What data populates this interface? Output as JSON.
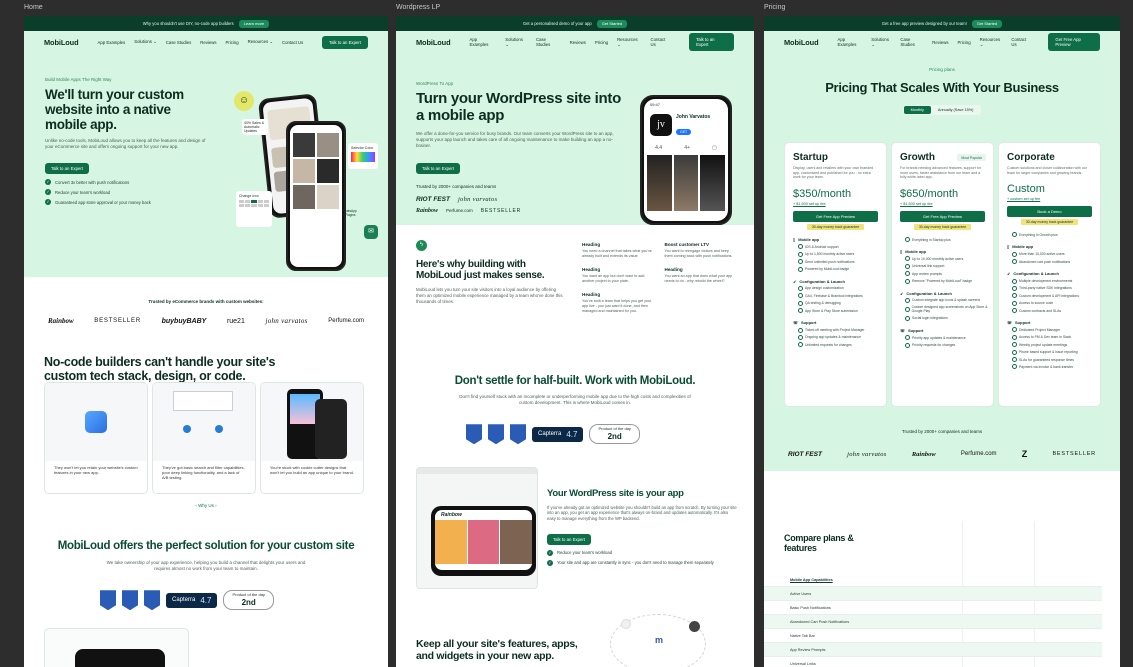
{
  "frames": {
    "home": {
      "label": "Home",
      "topbar": {
        "text": "Why you shouldn't use DIY, no-code app builders",
        "cta": "Learn more"
      },
      "nav": {
        "logo": "MobiLoud",
        "items": [
          "App Examples",
          "Solutions ⌄",
          "Case Studies",
          "Reviews",
          "Pricing",
          "Resources ⌄",
          "Contact Us"
        ],
        "cta": "Talk to an Expert"
      },
      "hero": {
        "eyebrow": "Build Mobile Apps The Right Way",
        "title": "We'll turn your custom website into a native mobile app.",
        "body": "Unlike no-code tools, MobiLoud allows you to keep all the features and design of your eCommerce site and offers ongoing support for your new app.",
        "cta": "Talk to an Expert",
        "checks": [
          "Convert 3x better with push notifications",
          "Reduce your team's workload",
          "Guaranteed app store approval or your money back"
        ]
      },
      "trusted": {
        "title": "Trusted by eCommerce brands with custom websites:",
        "brands": [
          "Rainbow",
          "BESTSELLER",
          "buybuyBABY",
          "rue21",
          "john varvatos",
          "Perfume.com"
        ]
      },
      "nocode": {
        "title": "No-code builders can't handle your site's custom tech stack, design, or code.",
        "cards": [
          "They won't let you retain your website's custom features in your new app.",
          "They've got basic search and filter capabilities, poor deep linking functionality, and a lack of A/B testing.",
          "You're stuck with cookie cutter designs that won't let you build an app unique to your brand."
        ],
        "why_link": "‹ Why Us ›"
      },
      "solution": {
        "title": "MobiLoud offers the perfect solution for your custom site",
        "body": "We take ownership of your app experience, helping you build a channel that delights your users and requires almost no work from your team to maintain."
      },
      "badges": {
        "capterra": "Capterra",
        "capterra_score": "4.7",
        "potd_label": "Product of the day",
        "potd_rank": "2nd"
      },
      "phone_labels": {
        "sale": "40% Sales & Automatic Updates",
        "selector": "Selector Color",
        "change_icon": "Change icon",
        "whatsapp": "WhatsApp & Plugins"
      }
    },
    "wordpress": {
      "label": "Wordpress LP",
      "topbar": {
        "text": "Get a personalised demo of your app",
        "cta": "Get Started"
      },
      "nav": {
        "logo": "MobiLoud",
        "items": [
          "App Examples",
          "Solutions ⌄",
          "Case Studies",
          "Reviews",
          "Pricing",
          "Resources ⌄",
          "Contact Us"
        ],
        "cta": "Talk to an Expert"
      },
      "hero": {
        "eyebrow": "WordPress To App",
        "title": "Turn your WordPress site into a mobile app",
        "body": "We offer a done-for-you service for busy brands. Our team converts your WordPress site to an app, supports your app launch and takes care of all ongoing maintenance to make building an app a no-brainer.",
        "cta": "Talk to an Expert",
        "trusted": "Trusted by 2000+ companies and teams",
        "brands": [
          "RIOT FEST",
          "john varvatos",
          "Rainbow",
          "Perfume.com",
          "BESTSELLER"
        ]
      },
      "phone": {
        "time": "09:47",
        "name": "John Varvatos",
        "rating": "4.4",
        "age": "4+",
        "get": "GET"
      },
      "why": {
        "title": "Here's why building with MobiLoud just makes sense.",
        "body": "MobiLoud lets you turn your site visitors into a loyal audience by offering them an optimized mobile experience managed by a team who've done this thousands of times.",
        "features": [
          {
            "title": "Heading",
            "body": "You need a channel that takes what you've already built and extends its value."
          },
          {
            "title": "Boost customer LTV",
            "body": "You want to reengage visitors and keep them coming back with push notifications."
          },
          {
            "title": "Heading",
            "body": "You want an app but don't want to add another project to your plate."
          },
          {
            "title": "Heading",
            "body": "You want an app that does what your app needs to do - why rebuild the wheel?"
          },
          {
            "title": "Heading",
            "body": "You've built a team that helps you get your app live - you just want it done, and then managed and maintained for you."
          }
        ]
      },
      "dont_settle": {
        "title": "Don't settle for half-built. Work with MobiLoud.",
        "body": "Don't find yourself stuck with an incomplete or underperforming mobile app due to the high costs and complexities of custom development. This is where MobiLoud comes in."
      },
      "badges": {
        "capterra": "Capterra",
        "capterra_score": "4.7",
        "potd_label": "Product of the day",
        "potd_rank": "2nd"
      },
      "your_app": {
        "title": "Your WordPress site is your app",
        "body": "If you've already got an optimized website you shouldn't build an app from scratch. By turning your site into an app, you get an app experience that's always on-brand and updates automatically. It's also easy to manage everything from the WP backend.",
        "cta": "Talk to an Expert",
        "checks": [
          "Reduce your team's workload",
          "Your site and app are constantly in sync - you don't need to manage them separately"
        ]
      },
      "keep": {
        "title": "Keep all your site's features, apps, and widgets in your new app."
      }
    },
    "pricing": {
      "label": "Pricing",
      "topbar": {
        "text": "Get a free app preview designed by our team!",
        "cta": "Get Started"
      },
      "nav": {
        "logo": "MobiLoud",
        "items": [
          "App Examples",
          "Solutions ⌄",
          "Case Studies",
          "Reviews",
          "Pricing",
          "Resources ⌄",
          "Contact Us"
        ],
        "cta": "Get Free App Preview"
      },
      "eyebrow": "Pricing plans",
      "title": "Pricing That Scales With Your Business",
      "toggle": {
        "monthly": "Monthly",
        "annual": "Annually (Save 15%)"
      },
      "plans": [
        {
          "name": "Startup",
          "desc": "Display, users and retailers with your own branded app, customized and published for you - no extra work for your team.",
          "price": "$350/month",
          "setup": "+ $1,500 set up fee",
          "cta": "Get Free App Preview",
          "guarantee": "30-day money back guarantee",
          "popular": "",
          "sections": [
            {
              "title": "Mobile app",
              "items": [
                "iOS & Android support",
                "Up to 1,500 monthly active users",
                "Send unlimited push notifications",
                "Powered by MobiLoud badge"
              ]
            },
            {
              "title": "Configuration & Launch",
              "items": [
                "App design customization",
                "GA4, Firebase & Braintool integrations",
                "QA testing & debugging",
                "App Store & Play Store submission"
              ]
            },
            {
              "title": "Support",
              "items": [
                "Ticket-off meeting with Project Manager",
                "Ongoing app updates & maintenance",
                "Unlimited requests for changes"
              ]
            }
          ]
        },
        {
          "name": "Growth",
          "desc": "For brands needing advanced features, support for more users, faster assistance from our team and a fully white-label app.",
          "price": "$650/month",
          "setup": "+ $1,500 set up fee",
          "cta": "Get Free App Preview",
          "guarantee": "30-day money back guarantee",
          "popular": "Most Popular",
          "sections": [
            {
              "title": "",
              "items": [
                "Everything in Startup plus"
              ]
            },
            {
              "title": "Mobile app",
              "items": [
                "Up to 10,000 monthly active users",
                "Universal link support",
                "App review prompts",
                "Remove \"Powered by MobiLoud\" badge"
              ]
            },
            {
              "title": "Configuration & Launch",
              "items": [
                "Custom integrate app icons & splash screens",
                "Custom designed app screenshots on App Store & Google Play",
                "Social login integrations"
              ]
            },
            {
              "title": "Support",
              "items": [
                "Priority app updates & maintenance",
                "Priority requests for changes"
              ]
            }
          ]
        },
        {
          "name": "Corporate",
          "desc": "Custom solutions and closer collaboration with our team for larger companies and growing brands.",
          "price": "Custom",
          "setup": "+ custom set up fee",
          "cta": "Book a Demo",
          "guarantee": "30-day money back guarantee",
          "popular": "",
          "sections": [
            {
              "title": "",
              "items": [
                "Everything in Growth plus"
              ]
            },
            {
              "title": "Mobile app",
              "items": [
                "More than 10,000 active users",
                "Abandoned cart push notifications"
              ]
            },
            {
              "title": "Configuration & Launch",
              "items": [
                "Multiple development environments",
                "Third-party native SDK integrations",
                "Custom development & API integrations",
                "Access to source code",
                "Custom contracts and SLAs"
              ]
            },
            {
              "title": "Support",
              "items": [
                "Dedicated Project Manager",
                "Access to PM & Dev team in Slack",
                "Weekly project update meetings",
                "Phone based support & issue reporting",
                "SLAs for guaranteed response times",
                "Payment via invoice & bank transfer"
              ]
            }
          ]
        }
      ],
      "trusted": "Trusted by 2000+ companies and teams",
      "brands": [
        "RIOT FEST",
        "john varvatos",
        "Rainbow",
        "Perfume.com",
        "Z",
        "BESTSELLER"
      ],
      "compare": {
        "title": "Compare plans & features",
        "group": "Mobile App Capabilities",
        "rows": [
          "Active Users",
          "Basic Push Notifications",
          "Abandoned Cart Push Notifications",
          "Native Tab Bar",
          "App Review Prompts",
          "Universal Links"
        ]
      }
    }
  }
}
